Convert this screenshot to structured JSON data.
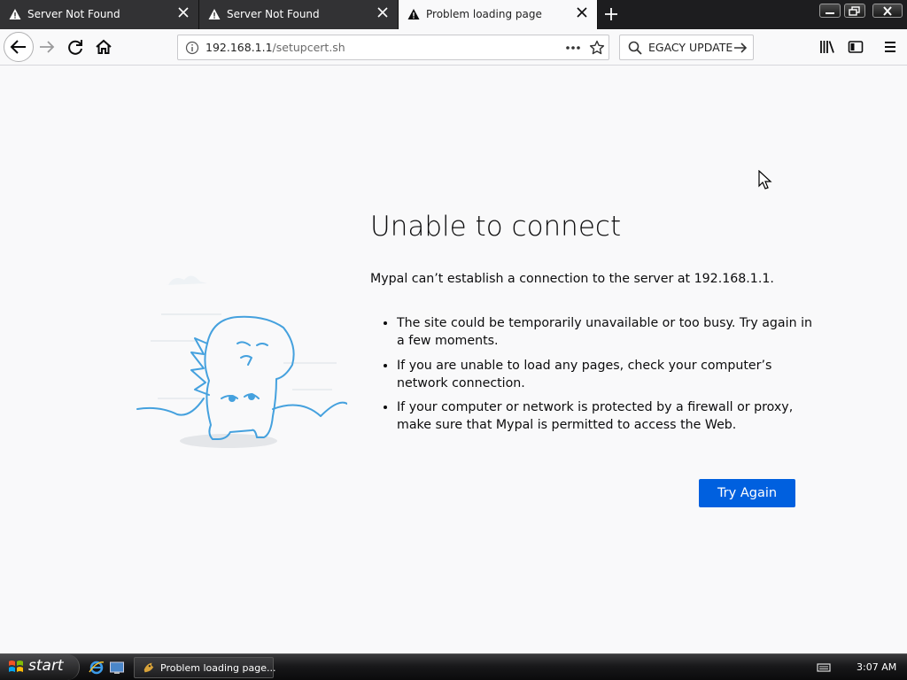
{
  "tabs": [
    {
      "title": "Server Not Found",
      "icon": "warning-icon",
      "active": false
    },
    {
      "title": "Server Not Found",
      "icon": "warning-icon",
      "active": false
    },
    {
      "title": "Problem loading page",
      "icon": "warning-icon",
      "active": true
    }
  ],
  "navbar": {
    "url_host": "192.168.1.1",
    "url_path": "/setupcert.sh",
    "search_value": "EGACY UPDATE"
  },
  "error_page": {
    "title": "Unable to connect",
    "description": "Mypal can’t establish a connection to the server at 192.168.1.1.",
    "items": [
      "The site could be temporarily unavailable or too busy. Try again in a few moments.",
      "If you are unable to load any pages, check your computer’s network connection.",
      "If your computer or network is protected by a firewall or proxy, make sure that Mypal is permitted to access the Web."
    ],
    "button_label": "Try Again"
  },
  "taskbar": {
    "start_label": "start",
    "task_label": "Problem loading page...",
    "clock": "3:07 AM"
  },
  "colors": {
    "accent": "#0060df",
    "illustration": "#45a1de"
  }
}
